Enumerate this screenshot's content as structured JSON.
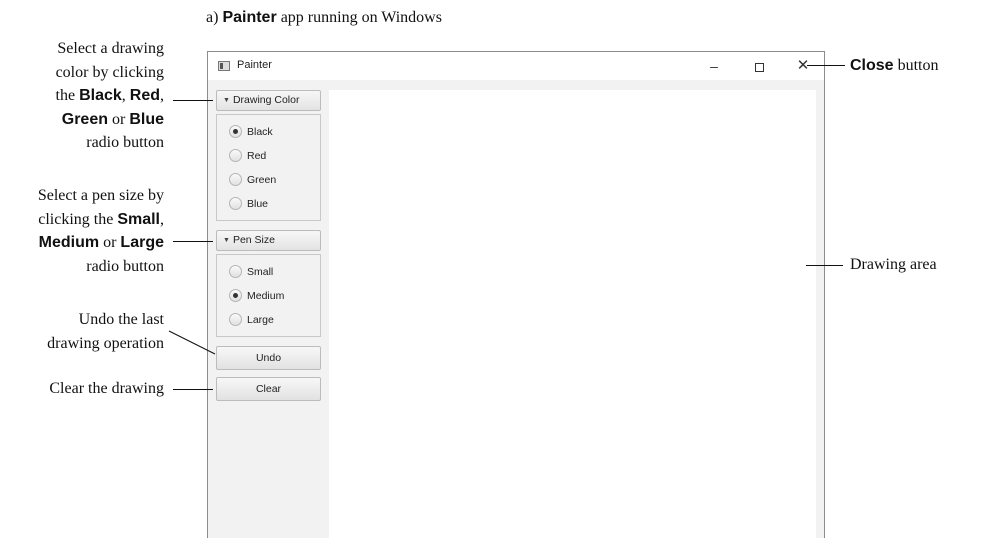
{
  "caption": {
    "prefix": "a) ",
    "bold": "Painter",
    "suffix": " app running on Windows"
  },
  "window": {
    "title": "Painter",
    "minimize_glyph": "–",
    "close_glyph": "✕"
  },
  "drawing_color": {
    "header": "Drawing Color",
    "options": [
      {
        "label": "Black",
        "selected": true
      },
      {
        "label": "Red",
        "selected": false
      },
      {
        "label": "Green",
        "selected": false
      },
      {
        "label": "Blue",
        "selected": false
      }
    ]
  },
  "pen_size": {
    "header": "Pen Size",
    "options": [
      {
        "label": "Small",
        "selected": false
      },
      {
        "label": "Medium",
        "selected": true
      },
      {
        "label": "Large",
        "selected": false
      }
    ]
  },
  "buttons": {
    "undo": "Undo",
    "clear": "Clear"
  },
  "annotations": {
    "color": {
      "l1": "Select a drawing",
      "l2": "color by clicking",
      "l3a": "the ",
      "black": "Black",
      "l3b": ", ",
      "red": "Red",
      "l3c": ",",
      "green": "Green",
      "l4a": " or ",
      "blue": "Blue",
      "l5": "radio button"
    },
    "pen": {
      "l1": "Select a pen size by",
      "l2a": "clicking the ",
      "small": "Small",
      "l2b": ",",
      "medium": "Medium",
      "l3a": " or ",
      "large": "Large",
      "l4": "radio button"
    },
    "undo": {
      "l1": "Undo the last",
      "l2": "drawing operation"
    },
    "clear": "Clear the drawing",
    "close": {
      "bold": "Close",
      "rest": " button"
    },
    "drawing_area": "Drawing area"
  }
}
